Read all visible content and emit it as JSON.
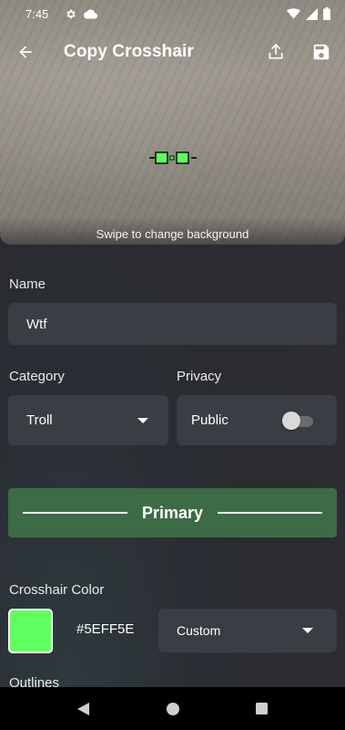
{
  "status_bar": {
    "time": "7:45",
    "left_icons": [
      "gear-icon",
      "cloud-icon"
    ],
    "right_icons": [
      "wifi-icon",
      "signal-icon",
      "battery-icon"
    ]
  },
  "app_bar": {
    "title": "Copy Crosshair",
    "back_icon": "arrow-left-icon",
    "share_icon": "upload-icon",
    "save_icon": "save-icon"
  },
  "preview": {
    "swipe_hint": "Swipe to change background"
  },
  "form": {
    "name_label": "Name",
    "name_value": "Wtf",
    "category_label": "Category",
    "category_value": "Troll",
    "privacy_label": "Privacy",
    "privacy_value": "Public",
    "privacy_toggle_on": false
  },
  "primary_tab": {
    "label": "Primary"
  },
  "crosshair_color": {
    "label": "Crosshair Color",
    "hex_text": "#5EFF5E",
    "swatch_color": "#5eff5e",
    "preset_value": "Custom"
  },
  "outlines": {
    "label": "Outlines"
  },
  "colors": {
    "accent_green": "#3d6b45",
    "field_background": "#3a3d43"
  },
  "nav_bar": {
    "icons": [
      "back-triangle-icon",
      "home-circle-icon",
      "recents-square-icon"
    ]
  }
}
